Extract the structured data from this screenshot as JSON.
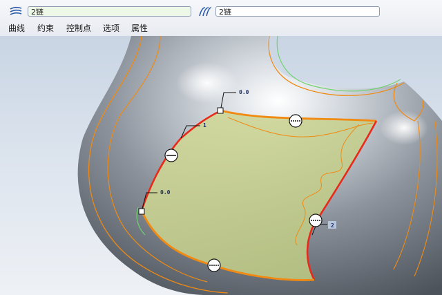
{
  "toolbar": {
    "chain_field_1": "2链",
    "chain_field_2": "2链",
    "icon_1": "surface-chain-icon",
    "icon_2": "boundary-chain-icon"
  },
  "menu": [
    {
      "label": "曲线"
    },
    {
      "label": "约束"
    },
    {
      "label": "控制点"
    },
    {
      "label": "选项"
    },
    {
      "label": "属性"
    }
  ],
  "viewport": {
    "dimension_labels": [
      "0.0",
      "1",
      "0.0",
      "2"
    ],
    "colors": {
      "surface_fill": "#c9d48a",
      "boundary_red": "#e82a1a",
      "boundary_orange": "#f08a12",
      "edge_green": "#6fd36f"
    }
  }
}
